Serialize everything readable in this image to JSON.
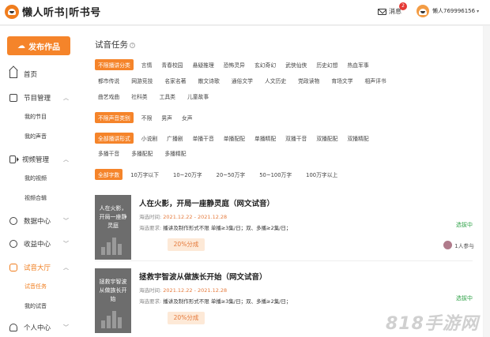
{
  "header": {
    "logo": "懒人听书|听书号",
    "messages_label": "消息",
    "messages_count": "2",
    "username": "懒人769996156",
    "caret": "▾"
  },
  "sidebar": {
    "publish_label": "发布作品",
    "home": "首页",
    "programs": "节目管理",
    "my_programs": "我的节目",
    "my_voices": "我的声音",
    "video": "视频管理",
    "my_videos": "我的视频",
    "video_collections": "视频合辑",
    "data_center": "数据中心",
    "income_center": "收益中心",
    "audition_hall": "试音大厅",
    "audition_tasks": "试音任务",
    "my_auditions": "我的试音",
    "personal_center": "个人中心"
  },
  "main": {
    "title": "试音任务",
    "genre_row1": [
      "不限播讲分类",
      "言情",
      "青春校园",
      "悬疑推理",
      "恐怖灵异",
      "玄幻奇幻",
      "武侠仙侠",
      "历史幻想",
      "热血军事"
    ],
    "genre_row2": [
      "都市传说",
      "网游竞技",
      "名家名著",
      "散文诗歌",
      "通俗文学",
      "人文历史",
      "党政读物",
      "育场文学",
      "相声评书"
    ],
    "genre_row3": [
      "曲艺戏曲",
      "社科类",
      "工具类",
      "儿童故事"
    ],
    "voice_row": [
      "不限声音类别",
      "不限",
      "男声",
      "女声"
    ],
    "style_row1": [
      "全部播讲形式",
      "小说剧",
      "广播剧",
      "单播干音",
      "单播配配",
      "单播精配",
      "双播干音",
      "双播配配",
      "双播精配"
    ],
    "style_row2": [
      "多播干音",
      "多播配配",
      "多播精配"
    ],
    "word_row": [
      "全部字数",
      "10万字以下",
      "10~20万字",
      "20~50万字",
      "50~100万字",
      "100万字以上"
    ],
    "cards": [
      {
        "thumb_text": "人在火影，开局一座静灵庭",
        "title": "人在火影，开局一座静灵庭（网文试音）",
        "date_label": "海选时间:",
        "date": "2021.12.22 - 2021.12.28",
        "req_label": "海选要求:",
        "req": "播讲及制作形式不限 单播≥3集/日；双、多播≥2集/日；",
        "share": "20%分成",
        "status": "选拔中",
        "people": "1人参与"
      },
      {
        "thumb_text": "拯救宇智波从做族长开始",
        "title": "拯救宇智波从做族长开始（网文试音）",
        "date_label": "海选时间:",
        "date": "2021.12.22 - 2021.12.28",
        "req_label": "海选要求:",
        "req": "播讲及制作形式不限 单播≥3集/日；双、多播≥2集/日；",
        "share": "20%分成",
        "status": "选拔中",
        "people": ""
      }
    ]
  },
  "watermark": "818手游网"
}
